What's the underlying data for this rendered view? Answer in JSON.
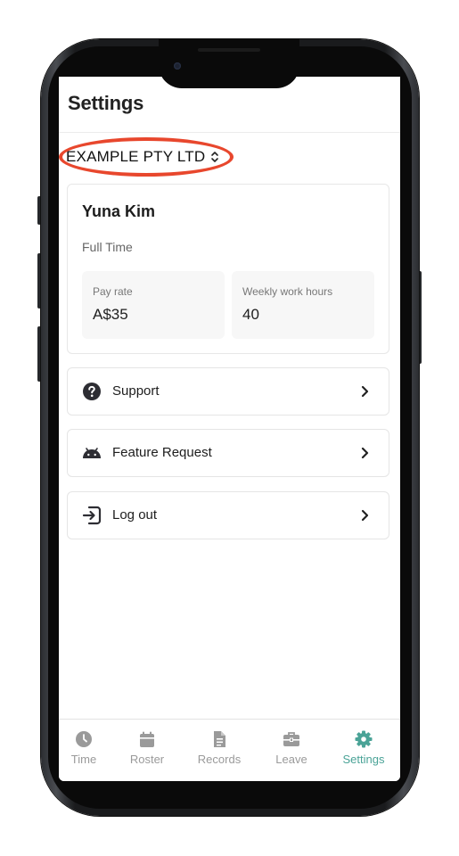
{
  "header": {
    "title": "Settings"
  },
  "company": {
    "name": "EXAMPLE PTY LTD"
  },
  "employee": {
    "name": "Yuna Kim",
    "employment_type": "Full Time",
    "pay_rate_label": "Pay rate",
    "pay_rate_value": "A$35",
    "weekly_hours_label": "Weekly work hours",
    "weekly_hours_value": "40"
  },
  "menu": [
    {
      "label": "Support",
      "icon": "question-circle-icon"
    },
    {
      "label": "Feature Request",
      "icon": "android-icon"
    },
    {
      "label": "Log out",
      "icon": "sign-in-icon"
    }
  ],
  "tabs": [
    {
      "label": "Time",
      "icon": "clock-icon",
      "active": false
    },
    {
      "label": "Roster",
      "icon": "calendar-icon",
      "active": false
    },
    {
      "label": "Records",
      "icon": "file-icon",
      "active": false
    },
    {
      "label": "Leave",
      "icon": "briefcase-icon",
      "active": false
    },
    {
      "label": "Settings",
      "icon": "gear-icon",
      "active": true
    }
  ],
  "colors": {
    "accent": "#4aa397",
    "highlight": "#e8472d",
    "inactive": "#9a9a9a"
  }
}
